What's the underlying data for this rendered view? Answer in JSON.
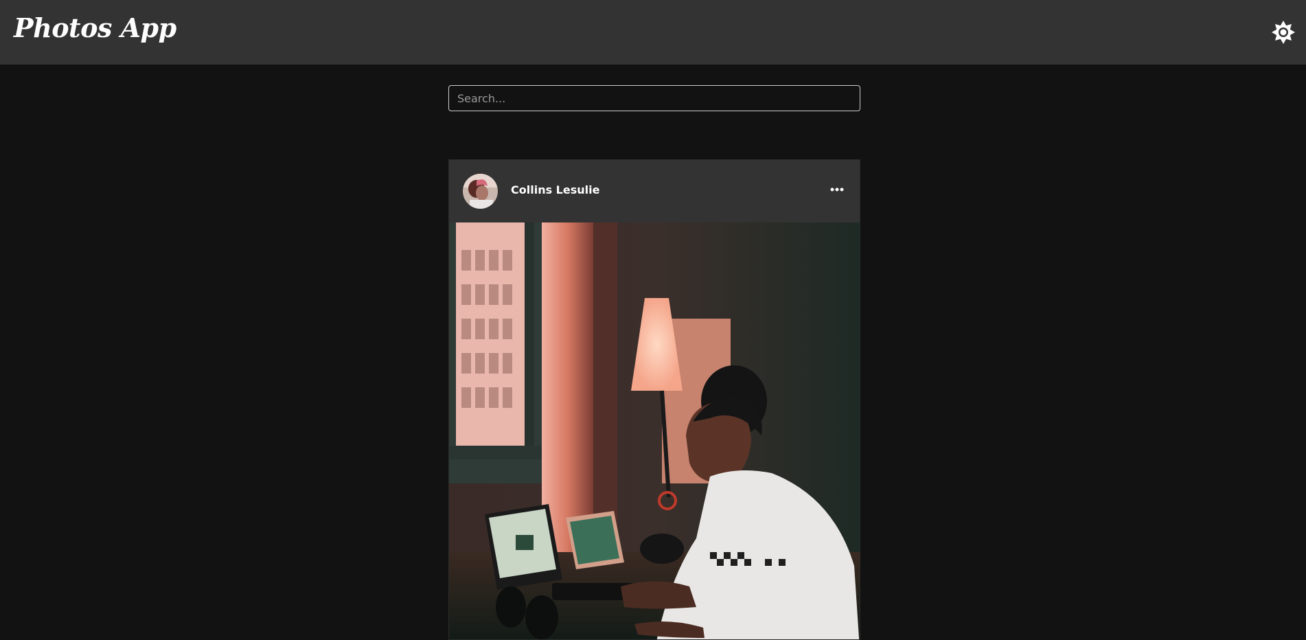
{
  "app": {
    "title": "Photos App",
    "theme_toggle_icon": "brightness-icon"
  },
  "search": {
    "placeholder": "Search...",
    "value": ""
  },
  "posts": [
    {
      "author": "Collins Lesulie",
      "avatar_icon": "avatar",
      "menu_icon": "more-horizontal-icon",
      "image_description_icon": "photo"
    }
  ],
  "colors": {
    "header_bg": "#333333",
    "page_bg": "#121212",
    "card_bg": "#333333",
    "text": "#ffffff"
  }
}
